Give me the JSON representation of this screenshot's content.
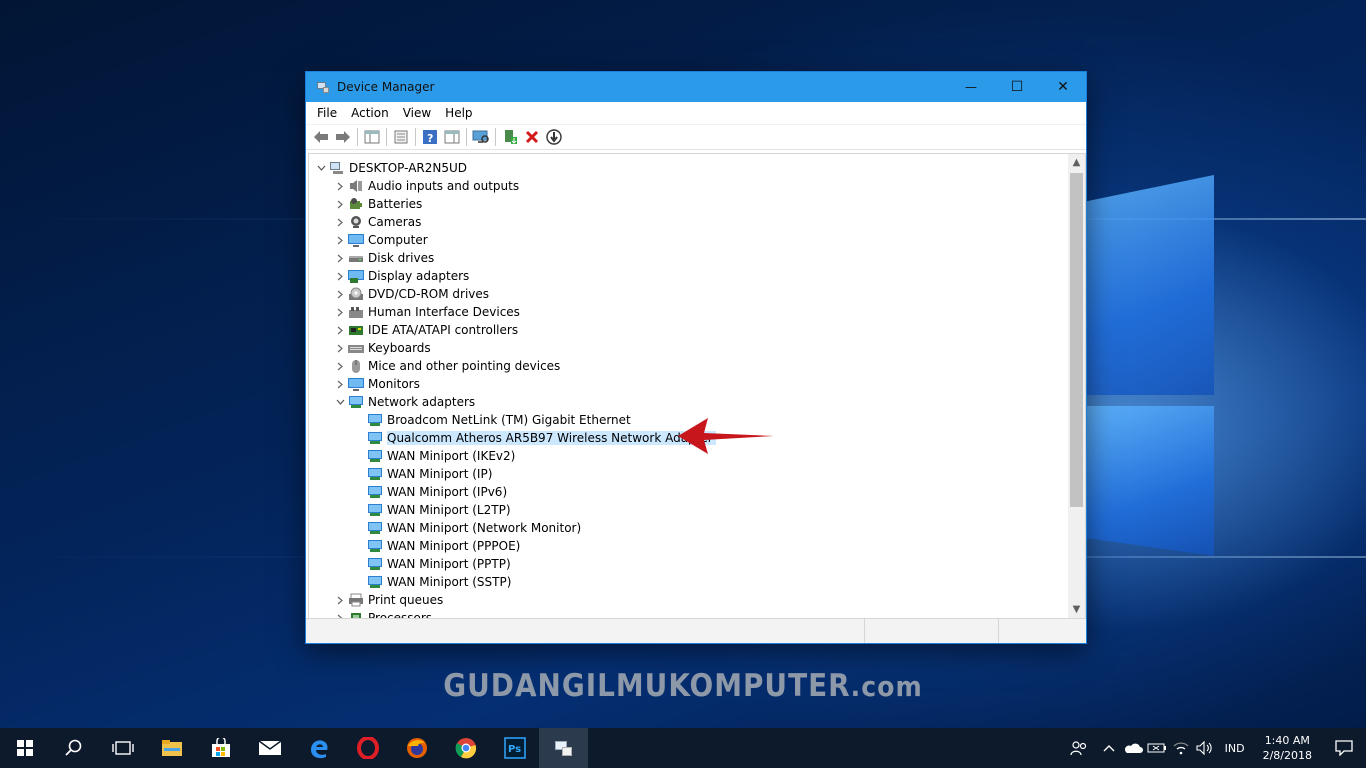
{
  "window": {
    "title": "Device Manager",
    "controls": {
      "minimize": "—",
      "maximize": "☐",
      "close": "✕"
    }
  },
  "menu": [
    "File",
    "Action",
    "View",
    "Help"
  ],
  "tree": {
    "root": "DESKTOP-AR2N5UD",
    "categories": [
      {
        "label": "Audio inputs and outputs",
        "icon": "speaker-icon"
      },
      {
        "label": "Batteries",
        "icon": "battery-icon"
      },
      {
        "label": "Cameras",
        "icon": "camera-icon"
      },
      {
        "label": "Computer",
        "icon": "monitor-icon"
      },
      {
        "label": "Disk drives",
        "icon": "disk-drive-icon"
      },
      {
        "label": "Display adapters",
        "icon": "display-adapter-icon"
      },
      {
        "label": "DVD/CD-ROM drives",
        "icon": "dvd-drive-icon"
      },
      {
        "label": "Human Interface Devices",
        "icon": "hid-icon"
      },
      {
        "label": "IDE ATA/ATAPI controllers",
        "icon": "ide-controller-icon"
      },
      {
        "label": "Keyboards",
        "icon": "keyboard-icon"
      },
      {
        "label": "Mice and other pointing devices",
        "icon": "mouse-icon"
      },
      {
        "label": "Monitors",
        "icon": "monitor-icon"
      },
      {
        "label": "Network adapters",
        "icon": "network-adapter-icon",
        "expanded": true
      },
      {
        "label": "Print queues",
        "icon": "printer-icon"
      },
      {
        "label": "Processors",
        "icon": "processor-icon"
      }
    ],
    "network_adapters": [
      "Broadcom NetLink (TM) Gigabit Ethernet",
      "Qualcomm Atheros AR5B97 Wireless Network Adapter",
      "WAN Miniport (IKEv2)",
      "WAN Miniport (IP)",
      "WAN Miniport (IPv6)",
      "WAN Miniport (L2TP)",
      "WAN Miniport (Network Monitor)",
      "WAN Miniport (PPPOE)",
      "WAN Miniport (PPTP)",
      "WAN Miniport (SSTP)"
    ],
    "selected": "Qualcomm Atheros AR5B97 Wireless Network Adapter"
  },
  "watermark": {
    "main": "GUDANGILMUKOMPUTER",
    "suffix": ".com"
  },
  "taskbar": {
    "apps": [
      "start-button",
      "search-icon",
      "task-view-icon",
      "file-explorer-icon",
      "store-icon",
      "mail-icon",
      "edge-icon",
      "opera-icon",
      "firefox-icon",
      "chrome-icon",
      "photoshop-icon",
      "device-manager-taskbar-icon"
    ],
    "language": "IND",
    "time": "1:40 AM",
    "date": "2/8/2018"
  },
  "colors": {
    "titlebar": "#2b9ae8",
    "selection": "#cce8ff",
    "arrow": "#c8161d",
    "taskbar": "#0d1a2c"
  }
}
